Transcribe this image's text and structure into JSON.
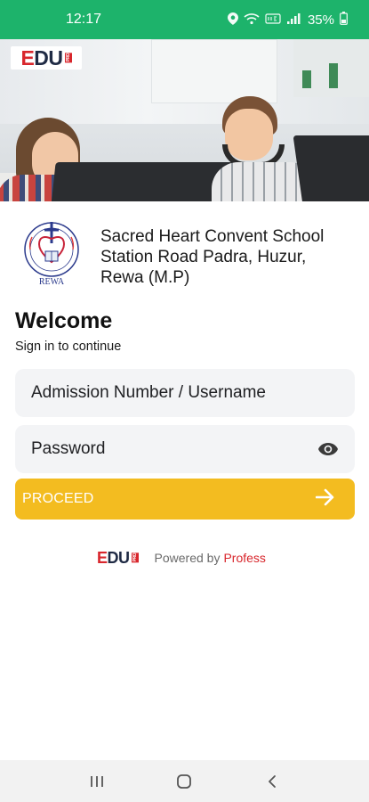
{
  "status_bar": {
    "time": "12:17",
    "battery": "35%",
    "icons": [
      "location-icon",
      "wifi-call-icon",
      "volte-icon",
      "signal-icon",
      "battery-icon"
    ]
  },
  "hero": {
    "logo": {
      "e": "E",
      "du": "DU",
      "tag": "PRO"
    }
  },
  "school": {
    "crest_text": "REWA",
    "name_lines": [
      "Sacred Heart Convent School",
      "Station Road Padra, Huzur,",
      "Rewa (M.P)"
    ]
  },
  "login": {
    "title": "Welcome",
    "subtitle": "Sign in to continue",
    "username_placeholder": "Admission Number / Username",
    "password_placeholder": "Password",
    "proceed_label": "PROCEED"
  },
  "footer": {
    "logo": {
      "e": "E",
      "du": "DU",
      "tag": "PRO"
    },
    "powered_by": "Powered by",
    "brand": "Profess"
  },
  "colors": {
    "status_bar": "#1db36b",
    "proceed": "#f3bc20",
    "brand_red": "#d8262c",
    "field_bg": "#f3f4f6"
  }
}
